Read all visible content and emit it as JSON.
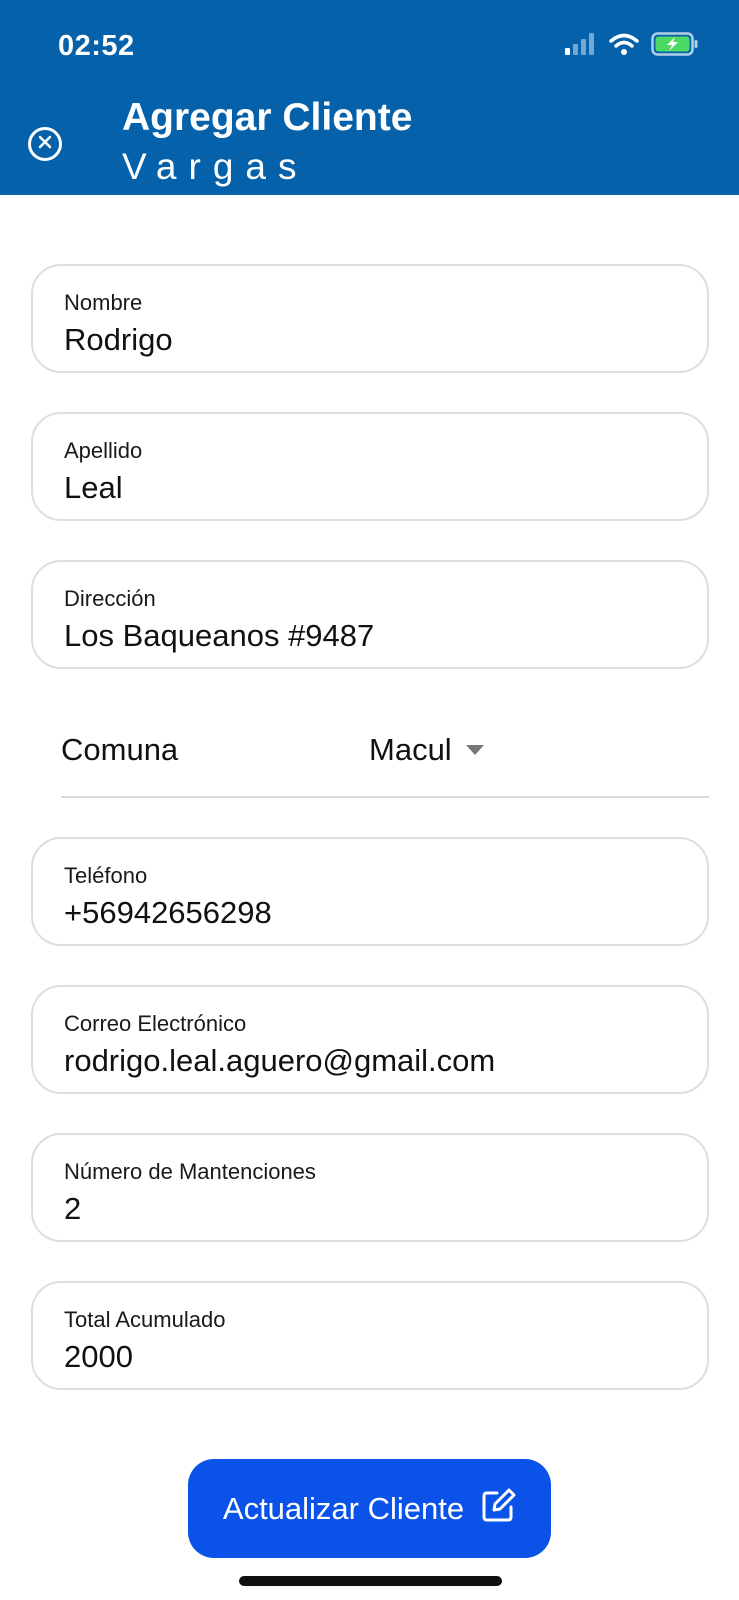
{
  "status_bar": {
    "time": "02:52",
    "icons": [
      "cellular-signal-icon",
      "wifi-icon",
      "battery-charging-icon"
    ]
  },
  "header": {
    "title": "Agregar Cliente",
    "subtitle": "Vargas",
    "close_icon": "close-circle-icon",
    "background_color": "#0461aa"
  },
  "form": {
    "nombre": {
      "label": "Nombre",
      "value": "Rodrigo"
    },
    "apellido": {
      "label": "Apellido",
      "value": "Leal"
    },
    "direccion": {
      "label": "Dirección",
      "value": "Los Baqueanos #9487"
    },
    "comuna": {
      "label": "Comuna",
      "selected": "Macul"
    },
    "telefono": {
      "label": "Teléfono",
      "value": "+56942656298"
    },
    "correo": {
      "label": "Correo Electrónico",
      "value": "rodrigo.leal.aguero@gmail.com"
    },
    "mantenciones": {
      "label": "Número de Mantenciones",
      "value": "2"
    },
    "total": {
      "label": "Total Acumulado",
      "value": "2000"
    }
  },
  "actions": {
    "update_label": "Actualizar Cliente",
    "update_icon": "edit-icon",
    "button_color": "#0b52e8"
  }
}
